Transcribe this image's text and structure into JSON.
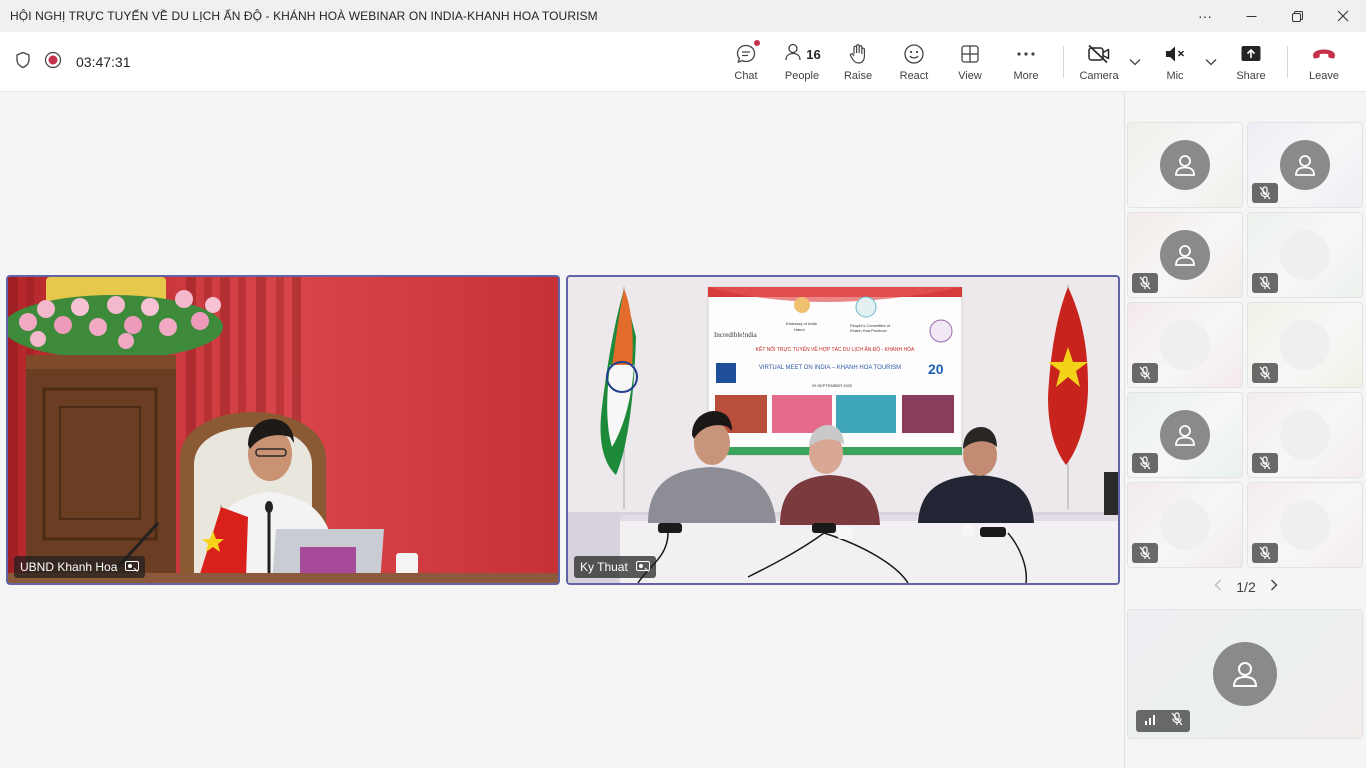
{
  "window": {
    "title": "HỘI NGHỊ TRỰC TUYẾN VỀ DU LỊCH ẤN ĐỘ - KHÁNH HOÀ WEBINAR ON INDIA-KHANH HOA TOURISM",
    "controls": [
      "more",
      "minimize",
      "restore",
      "close"
    ]
  },
  "toolbar": {
    "timer": "03:47:31",
    "chat_label": "Chat",
    "people_label": "People",
    "people_count": "16",
    "raise_label": "Raise",
    "react_label": "React",
    "view_label": "View",
    "more_label": "More",
    "camera_label": "Camera",
    "mic_label": "Mic",
    "share_label": "Share",
    "leave_label": "Leave",
    "leave_color": "#c4314b"
  },
  "stage": {
    "tiles": [
      {
        "name": "UBND Khanh Hoa"
      },
      {
        "name": "Ky Thuat"
      }
    ],
    "screen_text": {
      "incredible_india": "Incredible!ndia",
      "embassy": "Embassy of India",
      "embassy_city": "Hanoi",
      "committee": "People's Committee of",
      "committee2": "Khanh Hoa Province",
      "vn_title": "KẾT NỐI TRỰC TUYẾN VỀ HỢP TÁC DU LỊCH ẤN ĐỘ - KHÁNH HÒA",
      "en_title": "VIRTUAL MEET ON INDIA – KHANH HOA TOURISM",
      "date": "29 SEPTEMBER 2020",
      "years": "20"
    }
  },
  "gallery": {
    "pager": "1/2",
    "tiles": [
      {
        "avatar": true,
        "muted": false,
        "bg": "#eef0ea"
      },
      {
        "avatar": true,
        "muted": true,
        "bg": "#eceef4"
      },
      {
        "avatar": true,
        "muted": true,
        "bg": "#f2ebe8"
      },
      {
        "avatar": false,
        "muted": true,
        "bg": "#ecf1ec"
      },
      {
        "avatar": false,
        "muted": true,
        "bg": "#f3e9ee"
      },
      {
        "avatar": false,
        "muted": true,
        "bg": "#eff2e6"
      },
      {
        "avatar": true,
        "muted": true,
        "bg": "#e9f0f0"
      },
      {
        "avatar": false,
        "muted": true,
        "bg": "#f3ecec"
      },
      {
        "avatar": false,
        "muted": true,
        "bg": "#f2eaea"
      },
      {
        "avatar": false,
        "muted": true,
        "bg": "#f4ecec"
      }
    ]
  }
}
